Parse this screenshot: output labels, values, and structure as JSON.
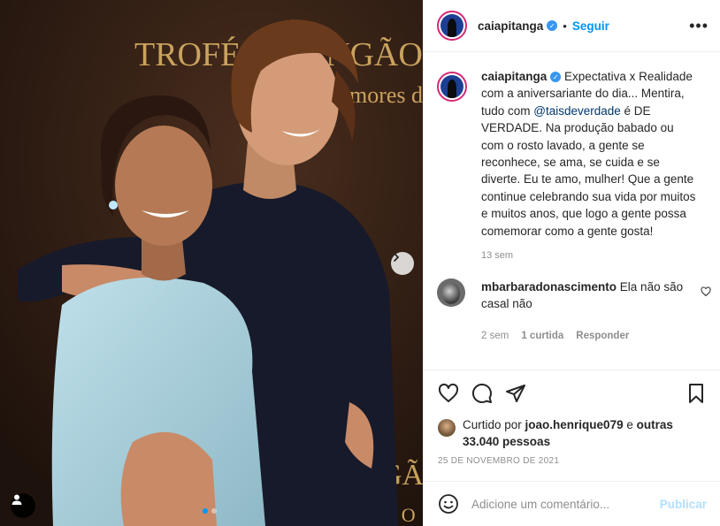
{
  "post": {
    "username": "caiapitanga",
    "verified": true,
    "follow_label": "Seguir",
    "caption": {
      "part1": "Expectativa x Realidade com a aniversariante do dia... Mentira, tudo com ",
      "mention": "@taisdeverdade",
      "part2": " é DE VERDADE. Na produção babado ou com o rosto lavado, a gente se reconhece, se ama, se cuida e se diverte. Eu te amo, mulher! Que a gente continue celebrando sua vida por muitos e muitos anos, que logo a gente possa comemorar como a gente gosta!"
    },
    "caption_time": "13 sem",
    "comment": {
      "username": "mbarbaradonascimento",
      "text": " Ela não são casal não",
      "time": "2 sem",
      "likes": "1 curtida",
      "reply_label": "Responder"
    },
    "likes": {
      "prefix": "Curtido por ",
      "user": "joao.henrique079",
      "middle": " e ",
      "others": "outras 33.040 pessoas"
    },
    "date": "25 DE NOVEMBRO DE 2021",
    "add_comment_placeholder": "Adicione um comentário...",
    "publish_label": "Publicar"
  },
  "media": {
    "backdrop_text_1": "TROFÉ",
    "backdrop_text_2": "NGÃO",
    "backdrop_text_3": "mores d",
    "backdrop_text_4": "GÃ",
    "backdrop_text_5": "S O",
    "carousel_position": 1,
    "carousel_count": 2
  },
  "icons": {
    "like": "heart-icon",
    "comment": "comment-icon",
    "share": "share-icon",
    "save": "bookmark-icon",
    "emoji": "emoji-icon",
    "more": "more-icon",
    "next": "chevron-right-icon",
    "tags": "user-tag-icon"
  },
  "colors": {
    "accent": "#0095f6",
    "verified": "#3897f0",
    "publish_disabled": "#b2dffc"
  }
}
